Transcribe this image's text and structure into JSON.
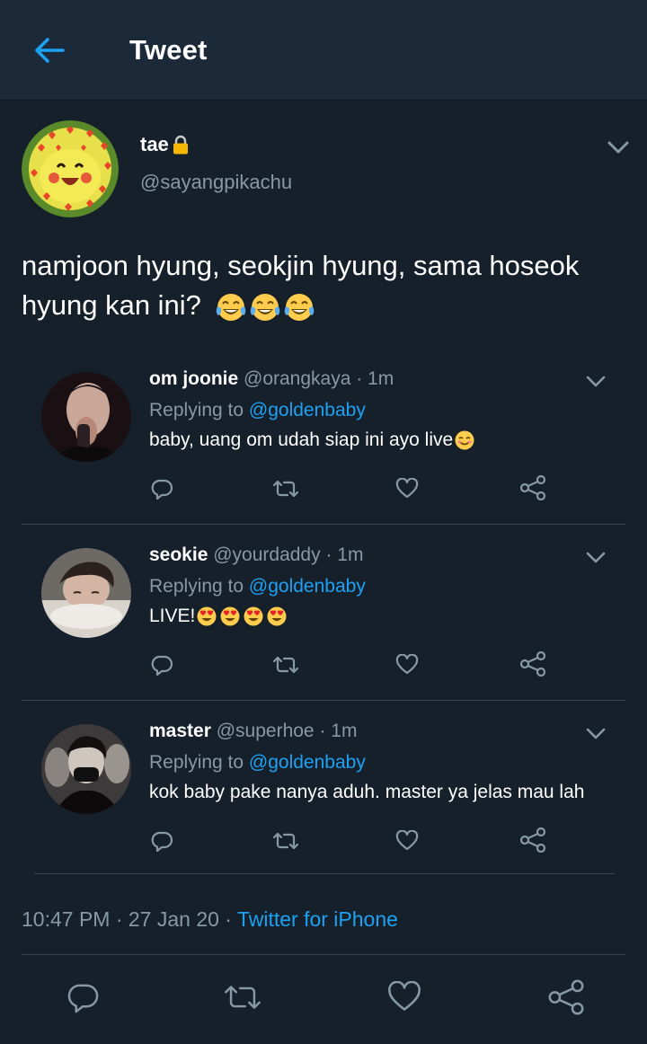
{
  "header": {
    "title": "Tweet",
    "back_icon": "arrow-left-icon"
  },
  "tweet": {
    "name": "tae",
    "handle": "@sayangpikachu",
    "text": "namjoon hyung, seokjin hyung, sama hoseok hyung kan ini?",
    "emoji": [
      "face-with-tears-of-joy-icon",
      "face-with-tears-of-joy-icon",
      "face-with-tears-of-joy-icon"
    ],
    "timestamp": "10:47 PM · 27 Jan 20 · ",
    "source": "Twitter for iPhone"
  },
  "replies": [
    {
      "name": "om joonie",
      "meta": " @orangkaya · 1m",
      "replying_prefix": "Replying to ",
      "replying_to": "@goldenbaby",
      "text": "baby, uang om udah siap ini ayo live",
      "emoji": [
        "smiling-face-icon"
      ]
    },
    {
      "name": "seokie",
      "meta": " @yourdaddy · 1m",
      "replying_prefix": "Replying to ",
      "replying_to": "@goldenbaby",
      "text": "LIVE!",
      "emoji": [
        "heart-eyes-icon",
        "heart-eyes-icon",
        "heart-eyes-icon",
        "heart-eyes-icon"
      ]
    },
    {
      "name": "master",
      "meta": " @superhoe · 1m",
      "replying_prefix": "Replying to ",
      "replying_to": "@goldenbaby",
      "text": "kok baby pake nanya aduh. master ya jelas mau lah",
      "emoji": []
    }
  ],
  "colors": {
    "background": "#15202b",
    "header": "#1c2938",
    "accent": "#1da1f2",
    "secondary_text": "#8899a6",
    "divider": "#38444d",
    "lock": "#f5b700"
  }
}
